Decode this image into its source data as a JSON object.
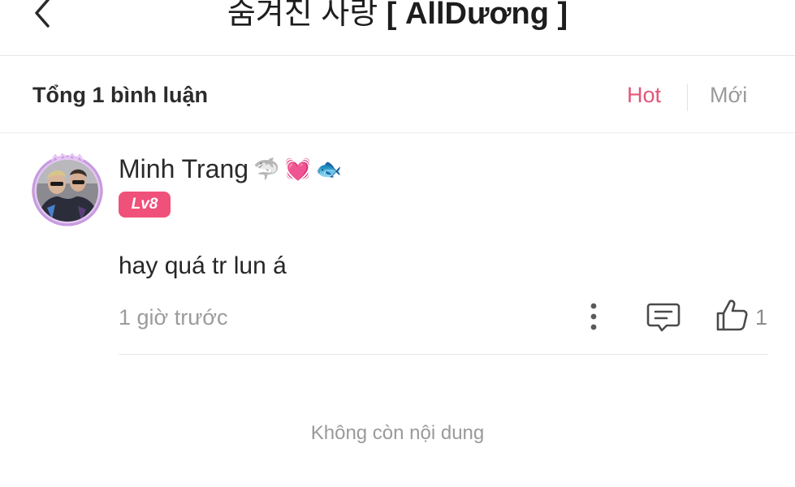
{
  "header": {
    "title_prefix": "숨겨진 사랑",
    "title_suffix": "[ AllDương ]",
    "back_icon": "chevron-left-icon"
  },
  "summary": {
    "count_label": "Tổng 1 bình luận",
    "sort_hot": "Hot",
    "sort_new": "Mới",
    "active_color": "#e4557a",
    "inactive_color": "#9a9a9a"
  },
  "comments": [
    {
      "username": "Minh Trang",
      "username_emojis": [
        "🦈",
        "💓",
        "🐟"
      ],
      "level": "Lv8",
      "level_color": "#f0517a",
      "text": "hay quá tr lun á",
      "time": "1 giờ trước",
      "likes": "1",
      "icons": {
        "more": "more-vertical-icon",
        "reply": "comment-icon",
        "like": "thumbs-up-icon"
      }
    }
  ],
  "footer": {
    "end_text": "Không còn nội dung"
  }
}
